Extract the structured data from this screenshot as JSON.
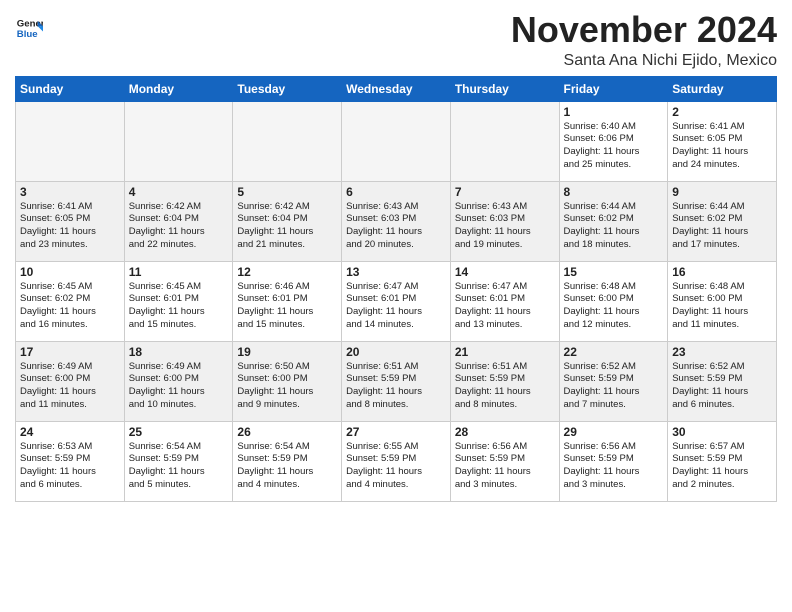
{
  "header": {
    "logo_general": "General",
    "logo_blue": "Blue",
    "month_title": "November 2024",
    "location": "Santa Ana Nichi Ejido, Mexico"
  },
  "weekdays": [
    "Sunday",
    "Monday",
    "Tuesday",
    "Wednesday",
    "Thursday",
    "Friday",
    "Saturday"
  ],
  "weeks": [
    [
      {
        "day": "",
        "info": ""
      },
      {
        "day": "",
        "info": ""
      },
      {
        "day": "",
        "info": ""
      },
      {
        "day": "",
        "info": ""
      },
      {
        "day": "",
        "info": ""
      },
      {
        "day": "1",
        "info": "Sunrise: 6:40 AM\nSunset: 6:06 PM\nDaylight: 11 hours\nand 25 minutes."
      },
      {
        "day": "2",
        "info": "Sunrise: 6:41 AM\nSunset: 6:05 PM\nDaylight: 11 hours\nand 24 minutes."
      }
    ],
    [
      {
        "day": "3",
        "info": "Sunrise: 6:41 AM\nSunset: 6:05 PM\nDaylight: 11 hours\nand 23 minutes."
      },
      {
        "day": "4",
        "info": "Sunrise: 6:42 AM\nSunset: 6:04 PM\nDaylight: 11 hours\nand 22 minutes."
      },
      {
        "day": "5",
        "info": "Sunrise: 6:42 AM\nSunset: 6:04 PM\nDaylight: 11 hours\nand 21 minutes."
      },
      {
        "day": "6",
        "info": "Sunrise: 6:43 AM\nSunset: 6:03 PM\nDaylight: 11 hours\nand 20 minutes."
      },
      {
        "day": "7",
        "info": "Sunrise: 6:43 AM\nSunset: 6:03 PM\nDaylight: 11 hours\nand 19 minutes."
      },
      {
        "day": "8",
        "info": "Sunrise: 6:44 AM\nSunset: 6:02 PM\nDaylight: 11 hours\nand 18 minutes."
      },
      {
        "day": "9",
        "info": "Sunrise: 6:44 AM\nSunset: 6:02 PM\nDaylight: 11 hours\nand 17 minutes."
      }
    ],
    [
      {
        "day": "10",
        "info": "Sunrise: 6:45 AM\nSunset: 6:02 PM\nDaylight: 11 hours\nand 16 minutes."
      },
      {
        "day": "11",
        "info": "Sunrise: 6:45 AM\nSunset: 6:01 PM\nDaylight: 11 hours\nand 15 minutes."
      },
      {
        "day": "12",
        "info": "Sunrise: 6:46 AM\nSunset: 6:01 PM\nDaylight: 11 hours\nand 15 minutes."
      },
      {
        "day": "13",
        "info": "Sunrise: 6:47 AM\nSunset: 6:01 PM\nDaylight: 11 hours\nand 14 minutes."
      },
      {
        "day": "14",
        "info": "Sunrise: 6:47 AM\nSunset: 6:01 PM\nDaylight: 11 hours\nand 13 minutes."
      },
      {
        "day": "15",
        "info": "Sunrise: 6:48 AM\nSunset: 6:00 PM\nDaylight: 11 hours\nand 12 minutes."
      },
      {
        "day": "16",
        "info": "Sunrise: 6:48 AM\nSunset: 6:00 PM\nDaylight: 11 hours\nand 11 minutes."
      }
    ],
    [
      {
        "day": "17",
        "info": "Sunrise: 6:49 AM\nSunset: 6:00 PM\nDaylight: 11 hours\nand 11 minutes."
      },
      {
        "day": "18",
        "info": "Sunrise: 6:49 AM\nSunset: 6:00 PM\nDaylight: 11 hours\nand 10 minutes."
      },
      {
        "day": "19",
        "info": "Sunrise: 6:50 AM\nSunset: 6:00 PM\nDaylight: 11 hours\nand 9 minutes."
      },
      {
        "day": "20",
        "info": "Sunrise: 6:51 AM\nSunset: 5:59 PM\nDaylight: 11 hours\nand 8 minutes."
      },
      {
        "day": "21",
        "info": "Sunrise: 6:51 AM\nSunset: 5:59 PM\nDaylight: 11 hours\nand 8 minutes."
      },
      {
        "day": "22",
        "info": "Sunrise: 6:52 AM\nSunset: 5:59 PM\nDaylight: 11 hours\nand 7 minutes."
      },
      {
        "day": "23",
        "info": "Sunrise: 6:52 AM\nSunset: 5:59 PM\nDaylight: 11 hours\nand 6 minutes."
      }
    ],
    [
      {
        "day": "24",
        "info": "Sunrise: 6:53 AM\nSunset: 5:59 PM\nDaylight: 11 hours\nand 6 minutes."
      },
      {
        "day": "25",
        "info": "Sunrise: 6:54 AM\nSunset: 5:59 PM\nDaylight: 11 hours\nand 5 minutes."
      },
      {
        "day": "26",
        "info": "Sunrise: 6:54 AM\nSunset: 5:59 PM\nDaylight: 11 hours\nand 4 minutes."
      },
      {
        "day": "27",
        "info": "Sunrise: 6:55 AM\nSunset: 5:59 PM\nDaylight: 11 hours\nand 4 minutes."
      },
      {
        "day": "28",
        "info": "Sunrise: 6:56 AM\nSunset: 5:59 PM\nDaylight: 11 hours\nand 3 minutes."
      },
      {
        "day": "29",
        "info": "Sunrise: 6:56 AM\nSunset: 5:59 PM\nDaylight: 11 hours\nand 3 minutes."
      },
      {
        "day": "30",
        "info": "Sunrise: 6:57 AM\nSunset: 5:59 PM\nDaylight: 11 hours\nand 2 minutes."
      }
    ]
  ]
}
